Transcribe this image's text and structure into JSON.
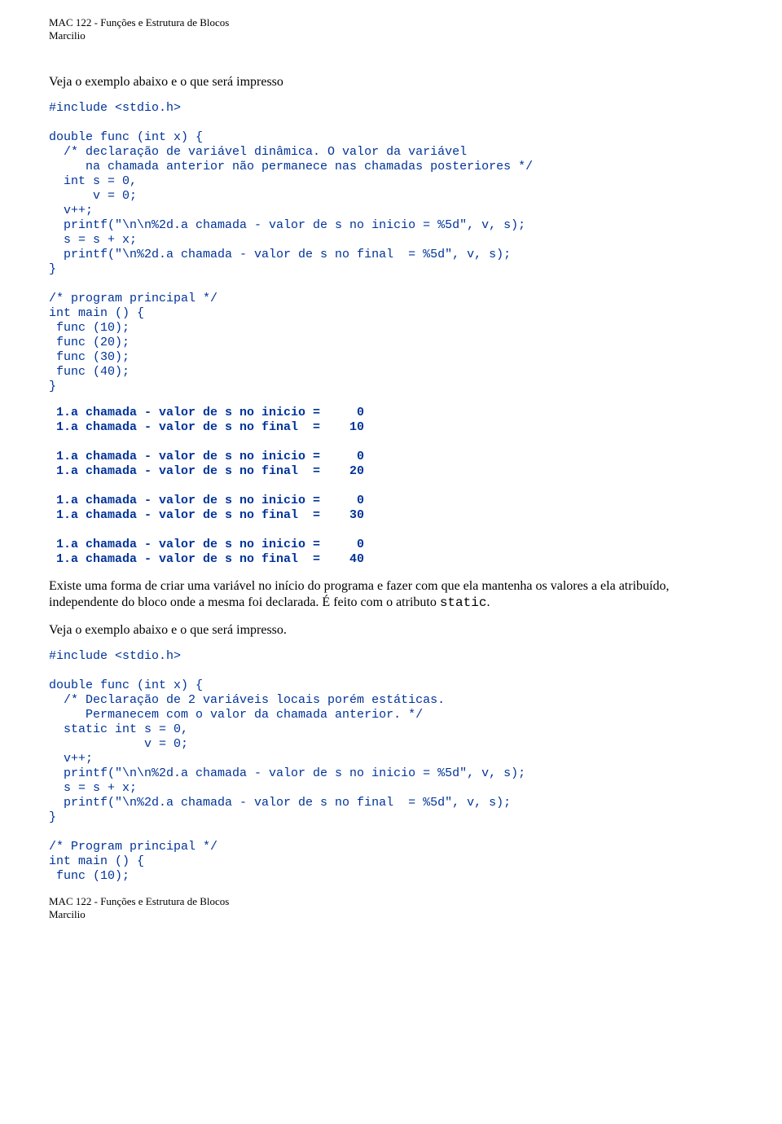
{
  "header": {
    "line1": "MAC 122 - Funções e Estrutura de Blocos",
    "line2": "Marcilio"
  },
  "intro1": "Veja o exemplo abaixo e o que será impresso",
  "code1": "#include <stdio.h>\n\ndouble func (int x) {\n  /* declaração de variável dinâmica. O valor da variável\n     na chamada anterior não permanece nas chamadas posteriores */\n  int s = 0,\n      v = 0;\n  v++;\n  printf(\"\\n\\n%2d.a chamada - valor de s no inicio = %5d\", v, s);\n  s = s + x;\n  printf(\"\\n%2d.a chamada - valor de s no final  = %5d\", v, s);\n}\n\n/* program principal */\nint main () {\n func (10);\n func (20);\n func (30);\n func (40);\n}",
  "output1": " 1.a chamada - valor de s no inicio =     0\n 1.a chamada - valor de s no final  =    10\n\n 1.a chamada - valor de s no inicio =     0\n 1.a chamada - valor de s no final  =    20\n\n 1.a chamada - valor de s no inicio =     0\n 1.a chamada - valor de s no final  =    30\n\n 1.a chamada - valor de s no inicio =     0\n 1.a chamada - valor de s no final  =    40",
  "para2a": "Existe uma forma de criar uma variável no início do programa e fazer com que ela mantenha os valores a ela atribuído, independente do bloco onde a mesma foi declarada. É feito com o atributo ",
  "para2b": "static",
  "para2c": ".",
  "intro2": "Veja o exemplo abaixo e o que será impresso.",
  "code2": "#include <stdio.h>\n\ndouble func (int x) {\n  /* Declaração de 2 variáveis locais porém estáticas.\n     Permanecem com o valor da chamada anterior. */\n  static int s = 0,\n             v = 0;\n  v++;\n  printf(\"\\n\\n%2d.a chamada - valor de s no inicio = %5d\", v, s);\n  s = s + x;\n  printf(\"\\n%2d.a chamada - valor de s no final  = %5d\", v, s);\n}\n\n/* Program principal */\nint main () {\n func (10);",
  "footer": {
    "line1": "MAC 122 - Funções e Estrutura de Blocos",
    "line2": "Marcilio"
  }
}
